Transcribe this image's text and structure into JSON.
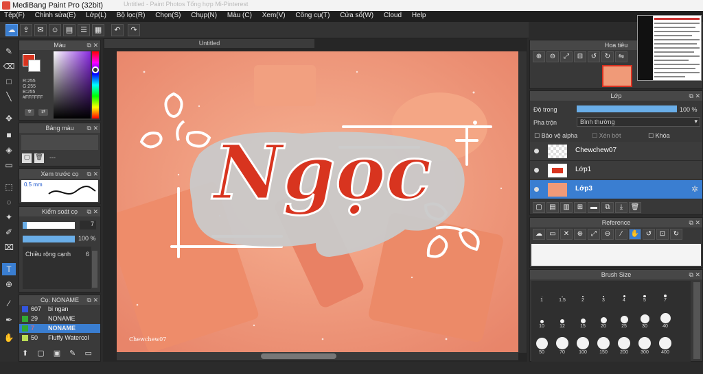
{
  "window": {
    "title": "MediBang Paint Pro (32bit)",
    "background_tabs": "Untitled - Paint    Photos    Tổng hợp    Mi-Pinterest"
  },
  "menu": [
    "Tệp(F)",
    "Chỉnh sửa(E)",
    "Lớp(L)",
    "Bộ lọc(R)",
    "Chọn(S)",
    "Chụp(N)",
    "Màu (C)",
    "Xem(V)",
    "Công cụ(T)",
    "Cửa sổ(W)",
    "Cloud",
    "Help"
  ],
  "canvas": {
    "tab_title": "Untitled",
    "artwork_text": "Ngọc",
    "signature": "Chewchew07\nlớp17"
  },
  "color_panel": {
    "title": "Màu",
    "r": "R:255",
    "g": "G:255",
    "b": "B:255",
    "hex": "#FFFFFF"
  },
  "palette_panel": {
    "title": "Bảng màu",
    "dash": "---"
  },
  "brush_preview_panel": {
    "title": "Xem trước cọ",
    "size": "0.5 mm"
  },
  "brush_control_panel": {
    "title": "Kiểm soát cọ",
    "size_value": "7",
    "opacity_value": "100 %",
    "width_label": "Chiều rộng cạnh",
    "width_value": "6"
  },
  "brush_list_panel": {
    "title": "Cọ: NONAME",
    "items": [
      {
        "size": "607",
        "name": "bi ngan",
        "color": "#3355dd"
      },
      {
        "size": "29",
        "name": "NONAME",
        "color": "#33aa33"
      },
      {
        "size": "7",
        "name": "NONAME",
        "color": "#33aa33"
      },
      {
        "size": "50",
        "name": "Fluffy Watercol",
        "color": "#bbdd55"
      }
    ]
  },
  "navigator_panel": {
    "title": "Hoa tiêu"
  },
  "layers_panel": {
    "title": "Lớp",
    "opacity_label": "Độ trong",
    "opacity_value": "100 %",
    "blend_label": "Pha trộn",
    "blend_value": "Bình thường",
    "protect_alpha": "Bảo vệ alpha",
    "clip": "Xén bớt",
    "lock": "Khóa",
    "layers": [
      {
        "name": "Chewchew07"
      },
      {
        "name": "Lớp1"
      },
      {
        "name": "Lớp3"
      }
    ]
  },
  "reference_panel": {
    "title": "Reference"
  },
  "brush_size_panel": {
    "title": "Brush Size",
    "sizes": [
      "1",
      "1.5",
      "2",
      "3",
      "4",
      "5",
      "7",
      "10",
      "12",
      "15",
      "20",
      "25",
      "30",
      "40",
      "50",
      "70",
      "100",
      "150",
      "200",
      "300",
      "400"
    ]
  },
  "colors": {
    "accent": "#3a7ed1",
    "canvas_peach": "#f09a78",
    "text_red": "#d8341f"
  }
}
